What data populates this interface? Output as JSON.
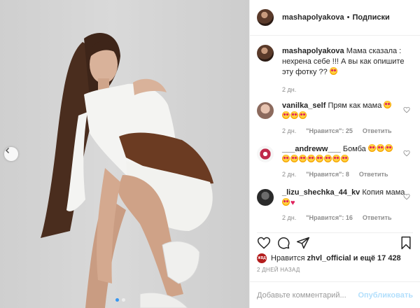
{
  "post": {
    "photo_alt_icon": "photo",
    "carousel": {
      "prev_icon": "chevron-left-icon",
      "total": 2,
      "active": 1
    }
  },
  "header": {
    "username": "mashapolyakova",
    "separator": "•",
    "follow_label": "Подписки"
  },
  "caption": {
    "username": "mashapolyakova",
    "text": "Мама сказала : нехрена себе !!! А вы как опишите эту фотку ??",
    "time": "2 дн."
  },
  "comments": [
    {
      "username": "vanilka_self",
      "text": "Прям как мама",
      "time": "2 дн.",
      "likes": "\"Нравится\": 25",
      "reply": "Ответить"
    },
    {
      "username": "___andreww___",
      "text": "Бомба",
      "time": "2 дн.",
      "likes": "\"Нравится\": 8",
      "reply": "Ответить"
    },
    {
      "username": "_lizu_shechka_44_kv",
      "text": "Копия мама",
      "time": "2 дн.",
      "likes": "\"Нравится\": 16",
      "reply": "Ответить"
    }
  ],
  "likes": {
    "badge": "ЖВД",
    "prefix": "Нравится",
    "user": "zhvl_official",
    "suffix": "и ещё 17 428"
  },
  "date": "2 ДНЕЙ НАЗАД",
  "add_comment": {
    "placeholder": "Добавьте комментарий...",
    "post_label": "Опубликовать"
  },
  "colors": {
    "accent": "#3897f0",
    "post_disabled": "#b2dffc",
    "muted": "#8e8e8e"
  }
}
